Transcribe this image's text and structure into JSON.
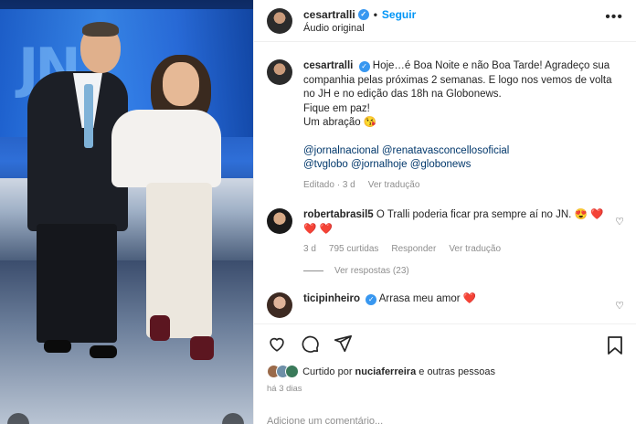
{
  "post": {
    "username": "cesartralli",
    "follow_label": "Seguir",
    "separator": "•",
    "audio_label": "Áudio original",
    "more_label": "•••"
  },
  "caption": {
    "username": "cesartralli",
    "line1": "Hoje…é Boa Noite e não Boa Tarde! Agradeço sua companhia pelas próximas 2 semanas. E logo nos vemos de volta no JH e no edição das 18h na Globonews.",
    "line2": "Fique em paz!",
    "line3": "Um abração",
    "line3_emoji": "😘",
    "mentions1": "@jornalnacional @renatavasconcellosoficial",
    "mentions2": "@tvglobo @jornalhoje @globonews",
    "edited": "Editado",
    "time": "3 d",
    "see_translation": "Ver tradução"
  },
  "comments": [
    {
      "username": "robertabrasil5",
      "text": "O Tralli poderia ficar pra sempre aí no JN.",
      "emoji": "😍 ❤️",
      "emoji2": "❤️ ❤️",
      "time": "3 d",
      "likes": "795 curtidas",
      "reply": "Responder",
      "translate": "Ver tradução",
      "view_replies": "Ver respostas (23)"
    },
    {
      "username": "ticipinheiro",
      "text": "Arrasa meu amor",
      "emoji": "❤️"
    }
  ],
  "footer": {
    "liked_by_prefix": "Curtido por",
    "liked_by_user": "nuciaferreira",
    "liked_by_suffix": "e outras pessoas",
    "ago": "há 3 dias",
    "add_comment": "Adicione um comentário..."
  },
  "photo": {
    "screen_text": "JN"
  }
}
